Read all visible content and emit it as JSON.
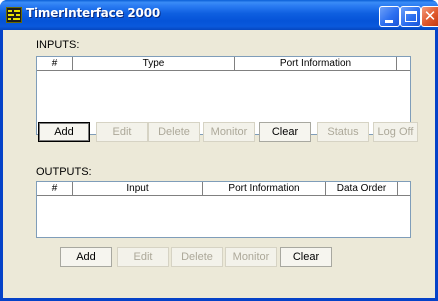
{
  "window": {
    "title": "TimerInterface 2000",
    "icon": "timer-app-icon",
    "controls": {
      "minimize_icon": "minimize-icon",
      "maximize_icon": "maximize-icon",
      "close_icon": "close-icon",
      "close_glyph": "✕"
    }
  },
  "inputs": {
    "label": "INPUTS:",
    "columns": [
      "#",
      "Type",
      "Port Information",
      ""
    ],
    "rows": [],
    "buttons": {
      "add": "Add",
      "edit": "Edit",
      "delete": "Delete",
      "monitor": "Monitor",
      "clear": "Clear",
      "status": "Status",
      "log_off": "Log Off"
    }
  },
  "outputs": {
    "label": "OUTPUTS:",
    "columns": [
      "#",
      "Input",
      "Port Information",
      "Data Order",
      ""
    ],
    "rows": [],
    "buttons": {
      "add": "Add",
      "edit": "Edit",
      "delete": "Delete",
      "monitor": "Monitor",
      "clear": "Clear"
    }
  },
  "colors": {
    "titlebar": "#0054e3",
    "client_bg": "#ece9d8",
    "disabled_text": "#aca899",
    "list_border": "#7f9db9"
  }
}
